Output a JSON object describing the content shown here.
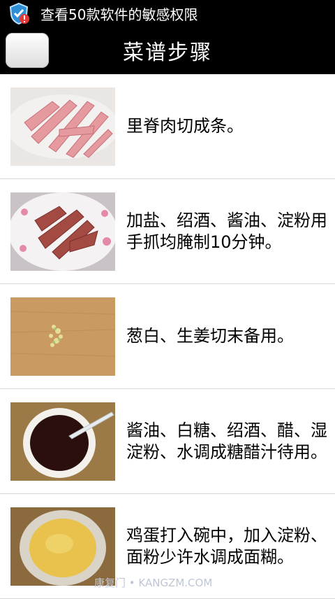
{
  "status_bar": {
    "notification_text": "查看50款软件的敏感权限",
    "icon": "shield-alert-icon"
  },
  "title_bar": {
    "title": "菜谱步骤",
    "back_icon": "back-button"
  },
  "steps": [
    {
      "text": "里脊肉切成条。",
      "image": "sliced-pork-strips"
    },
    {
      "text": "加盐、绍酒、酱油、淀粉用手抓均腌制10分钟。",
      "image": "marinated-pork-on-plate"
    },
    {
      "text": "葱白、生姜切末备用。",
      "image": "minced-scallion-ginger-on-board"
    },
    {
      "text": "酱油、白糖、绍酒、醋、湿淀粉、水调成糖醋汁待用。",
      "image": "soy-sauce-in-bowl"
    },
    {
      "text": "鸡蛋打入碗中，加入淀粉、面粉少许水调成面糊。",
      "image": "egg-batter-in-bowl"
    }
  ],
  "watermark": "康复门 • KANGZM.COM"
}
